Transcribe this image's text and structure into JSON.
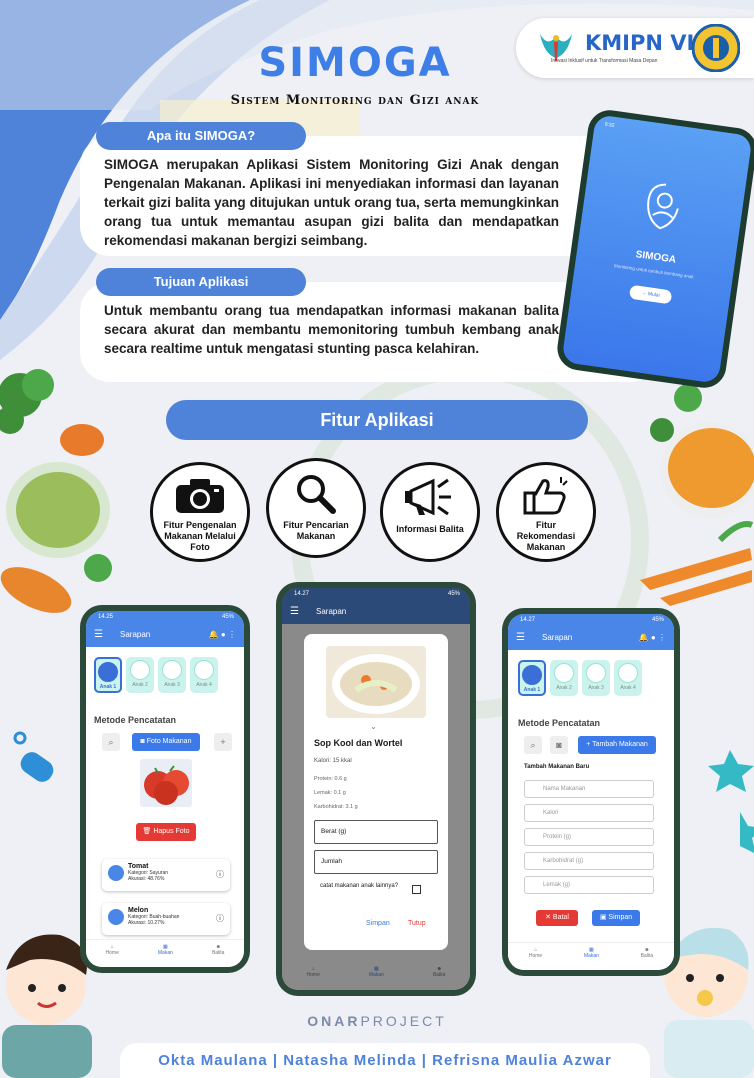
{
  "header": {
    "title": "SIMOGA",
    "subtitle": "Sistem Monitoring dan Gizi anak",
    "logo_text": "KMIPN VI",
    "logo_tagline": "Inovasi Inklusif untuk Transformasi Masa Depan"
  },
  "about": {
    "heading": "Apa itu SIMOGA?",
    "text": "SIMOGA merupakan Aplikasi Sistem Monitoring Gizi Anak dengan Pengenalan Makanan. Aplikasi ini menyediakan informasi dan layanan terkait gizi balita yang ditujukan untuk orang tua, serta memungkinkan orang tua untuk memantau asupan gizi balita dan mendapatkan rekomendasi makanan bergizi seimbang."
  },
  "goal": {
    "heading": "Tujuan Aplikasi",
    "text": "Untuk membantu orang tua mendapatkan informasi makanan balita secara akurat dan membantu memonitoring tumbuh kembang anak secara realtime untuk mengatasi stunting pasca kelahiran."
  },
  "splash_phone": {
    "app_name": "SIMOGA",
    "tagline": "Monitoring untuk tumbuh kembang anak",
    "button": "Mulai",
    "time": "9:32"
  },
  "features": {
    "heading": "Fitur Aplikasi",
    "items": [
      {
        "label": "Fitur Pengenalan Makanan Melalui Foto",
        "icon": "camera-icon"
      },
      {
        "label": "Fitur Pencarian Makanan",
        "icon": "search-icon"
      },
      {
        "label": "Informasi Balita",
        "icon": "megaphone-icon"
      },
      {
        "label": "Fitur Rekomendasi Makanan",
        "icon": "thumbs-up-icon"
      }
    ]
  },
  "phone_left": {
    "time": "14.25",
    "battery": "45%",
    "title": "Sarapan",
    "kids": [
      "Anak 1",
      "Anak 2",
      "Anak 3",
      "Anak 4"
    ],
    "section": "Metode Pencatatan",
    "photo_button": "Foto Makanan",
    "delete_button": "Hapus Foto",
    "foods": [
      {
        "name": "Tomat",
        "category": "Kategori: Sayuran",
        "accuracy": "Akurasi: 48.76%"
      },
      {
        "name": "Melon",
        "category": "Kategori: Buah-buahan",
        "accuracy": "Akurasi: 10.27%"
      }
    ],
    "nav": [
      "Home",
      "Makan",
      "Balita"
    ]
  },
  "phone_middle": {
    "time": "14.27",
    "battery": "45%",
    "title": "Sarapan",
    "dish": "Sop Kool dan Wortel",
    "calories": "Kalori: 15 kkal",
    "protein": "Protein: 0.6 g",
    "fat": "Lemak: 0.1 g",
    "carbs": "Karbohidrat: 3.1 g",
    "weight_placeholder": "Berat (g)",
    "qty_placeholder": "Jumlah",
    "other_child": "catat makanan anak lainnya?",
    "save": "Simpan",
    "close": "Tutup",
    "nav": [
      "Home",
      "Makan",
      "Balita"
    ]
  },
  "phone_right": {
    "time": "14.27",
    "battery": "45%",
    "title": "Sarapan",
    "kids": [
      "Anak 1",
      "Anak 2",
      "Anak 3",
      "Anak 4"
    ],
    "section": "Metode Pencatatan",
    "add_button": "Tambah Makanan",
    "form_title": "Tambah Makanan Baru",
    "fields": [
      "Nama Makanan",
      "Kalori",
      "Protein (g)",
      "Karbohidrat (g)",
      "Lemak (g)"
    ],
    "cancel": "Batal",
    "save": "Simpan",
    "nav": [
      "Home",
      "Makan",
      "Balita"
    ]
  },
  "footer": {
    "brand_bold": "ONAR",
    "brand_light": "PROJECT",
    "names": "Okta Maulana | Natasha Melinda | Refrisna Maulia Azwar"
  },
  "colors": {
    "primary": "#4f82d9",
    "appbar": "#4a86e8",
    "danger": "#e53935"
  }
}
